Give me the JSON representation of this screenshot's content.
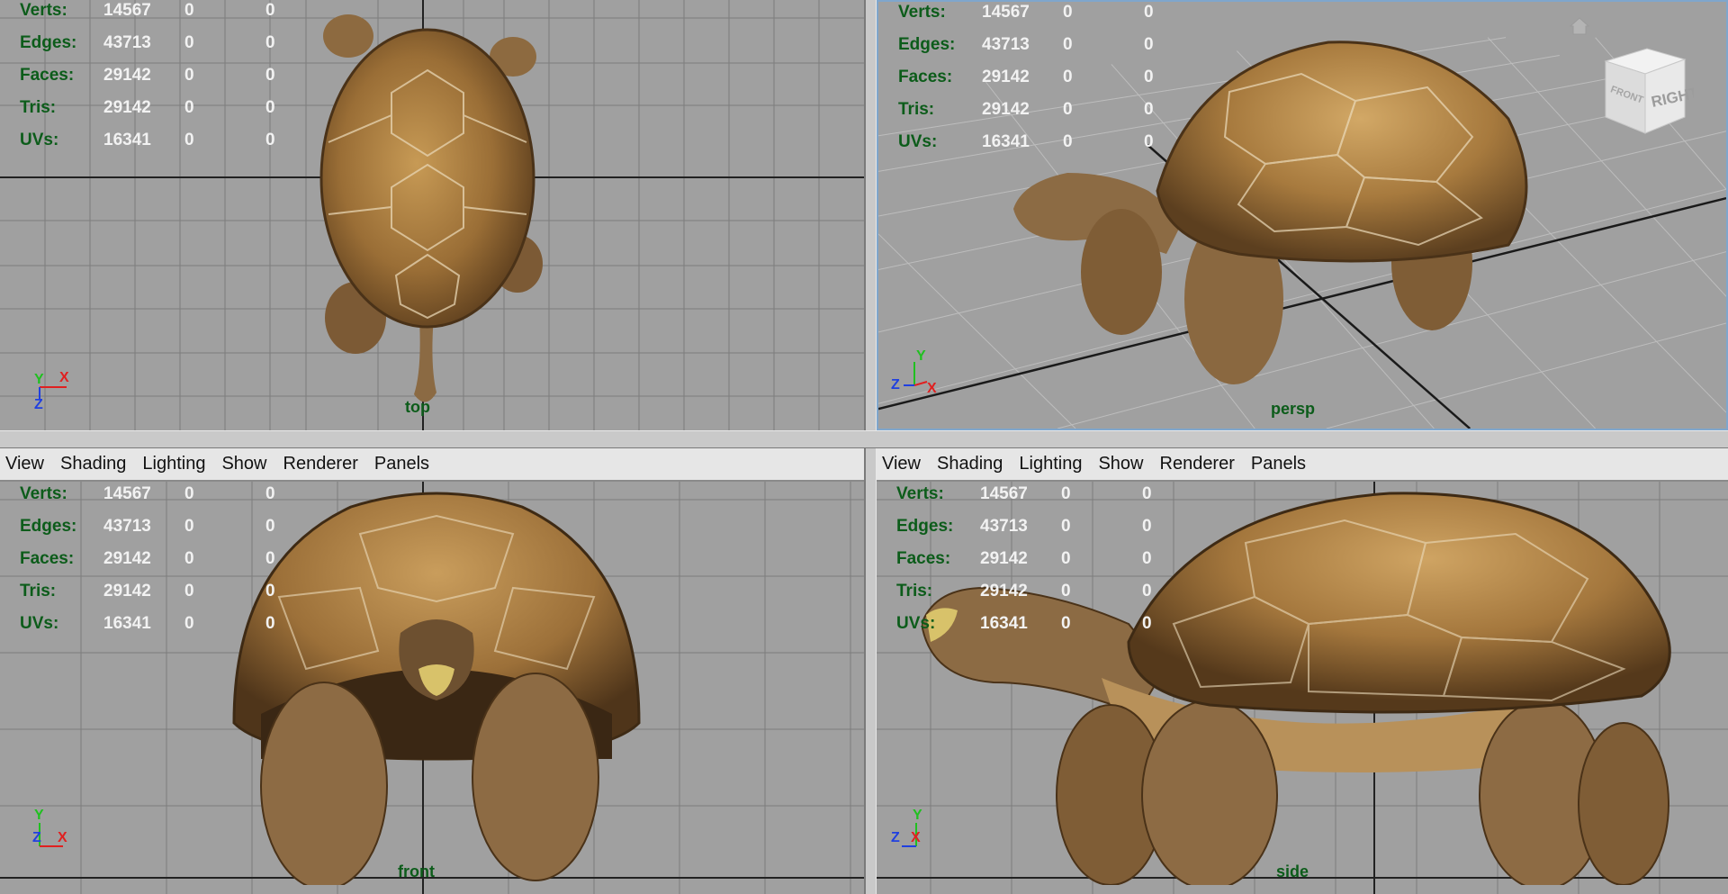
{
  "menubar": {
    "items": [
      "View",
      "Shading",
      "Lighting",
      "Show",
      "Renderer",
      "Panels"
    ]
  },
  "hud": {
    "rows": [
      {
        "label": "Verts:",
        "value": "14567",
        "a": "0",
        "b": "0"
      },
      {
        "label": "Edges:",
        "value": "43713",
        "a": "0",
        "b": "0"
      },
      {
        "label": "Faces:",
        "value": "29142",
        "a": "0",
        "b": "0"
      },
      {
        "label": "Tris:",
        "value": "29142",
        "a": "0",
        "b": "0"
      },
      {
        "label": "UVs:",
        "value": "16341",
        "a": "0",
        "b": "0"
      }
    ]
  },
  "viewports": {
    "top": {
      "camera": "top"
    },
    "persp": {
      "camera": "persp"
    },
    "front": {
      "camera": "front"
    },
    "side": {
      "camera": "side"
    }
  },
  "axes": {
    "x": "X",
    "y": "Y",
    "z": "Z"
  },
  "viewcube": {
    "face_label": "RIGHT",
    "side_label": "FRONT"
  },
  "colors": {
    "viewport_bg": "#a0a0a0",
    "hud_label": "#0c5c1a",
    "hud_value": "#f2f2f2",
    "axis_x": "#e02020",
    "axis_y": "#20c020",
    "axis_z": "#2040e0"
  }
}
